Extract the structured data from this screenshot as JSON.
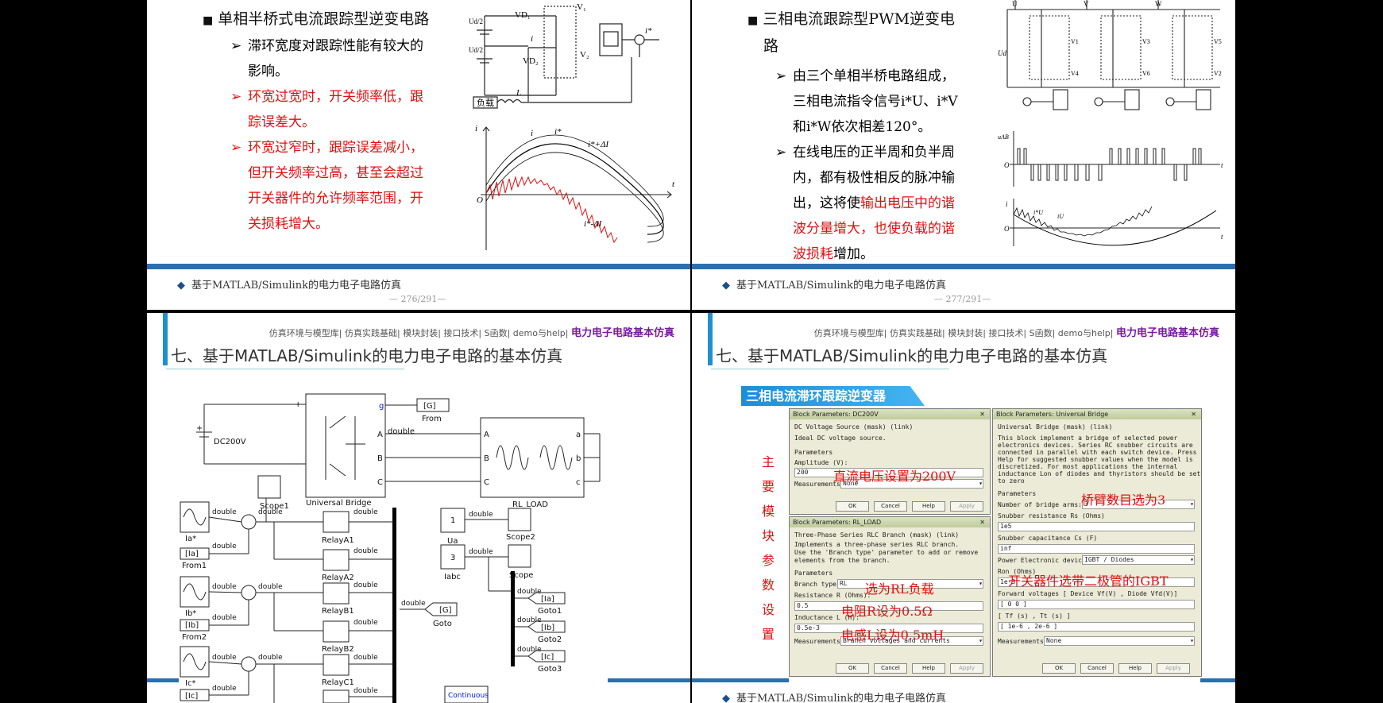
{
  "slide1": {
    "heading": "单相半桥式电流跟踪型逆变电路",
    "bullets": [
      {
        "text": "滞环宽度对跟踪性能有较大的",
        "cont": "影响。",
        "red": false
      },
      {
        "text": "环宽过宽时，开关频率低，跟",
        "cont": "踪误差大。",
        "red": true
      },
      {
        "text": "环宽过窄时，跟踪误差减小，",
        "cont": "但开关频率过高，甚至会超过",
        "cont2": "开关器件的允许频率范围，开",
        "cont3": "关损耗增大。",
        "red": true
      }
    ],
    "footer": "基于MATLAB/Simulink的电力电子电路仿真",
    "page": "— 276/291—",
    "circuit": {
      "load": "负载",
      "vd1": "VD₁",
      "vd2": "VD₂",
      "v1": "V₁",
      "v2": "V₂",
      "ud2a": "Ud/2",
      "ud2b": "Ud/2",
      "L": "L",
      "i": "i",
      "istar": "i*"
    },
    "wave": {
      "i": "i",
      "istar": "i*",
      "upper": "i*+ΔI",
      "lower": "i*-ΔI",
      "o": "O",
      "t": "t",
      "yi": "i"
    }
  },
  "slide2": {
    "heading1": "三相电流跟踪型PWM逆变电",
    "heading2": "路",
    "b1_l1": "由三个单相半桥电路组成，",
    "b1_l2": "三相电流指令信号i*U、i*V",
    "b1_l3": "和i*W依次相差120°。",
    "b2_l1": "在线电压的正半周和负半周",
    "b2_l2": "内，都有极性相反的脉冲输",
    "b2_l3a": "出，这将使",
    "b2_l3b": "输出电压中的谐",
    "b2_l4a": "波分量增大，也使",
    "b2_l4b": "负载的谐",
    "b2_l5a": "波损耗",
    "b2_l5b": "增加。",
    "footer": "基于MATLAB/Simulink的电力电子电路仿真",
    "page": "— 277/291—",
    "circuit": {
      "u": "U",
      "v": "V",
      "w": "W",
      "ud": "Ud",
      "v1": "V1",
      "v3": "V3",
      "v5": "V5",
      "v4": "V4",
      "v6": "V6",
      "v2": "V2"
    },
    "wave": {
      "uab": "uAB",
      "o": "O",
      "t": "t",
      "o2": "O",
      "t2": "t",
      "i": "i",
      "iu": "iU",
      "iustar": "i*U"
    }
  },
  "slide3": {
    "nav": "仿真环境与模型库| 仿真实践基础| 模块封装| 接口技术| S函数| demo与help|",
    "nav_bold": "电力电子电路基本仿真",
    "title": "七、基于MATLAB/Simulink的电力电子电路的基本仿真",
    "labels": {
      "dc": "DC200V",
      "ub": "Universal Bridge",
      "rl": "RL_LOAD",
      "from": "From",
      "g": "[G]",
      "double": "double",
      "scope1": "Scope1",
      "scope2": "Scope2",
      "scope": "Scope",
      "ua": "Ua",
      "iabc": "Iabc",
      "ia": "Ia*",
      "ib": "Ib*",
      "ic": "Ic*",
      "from1": "From1",
      "from2": "From2",
      "iatag": "[Ia]",
      "ibtag": "[Ib]",
      "ictag": "[Ic]",
      "ra1": "RelayA1",
      "ra2": "RelayA2",
      "rb1": "RelayB1",
      "rb2": "RelayB2",
      "rc1": "RelayC1",
      "goto": "Goto",
      "goto1": "Goto1",
      "goto2": "Goto2",
      "goto3": "Goto3",
      "one": "1",
      "three": "3",
      "cont": "Continuous",
      "pA": "A",
      "pB": "B",
      "pC": "C",
      "pa": "a",
      "pb": "b",
      "pc": "c",
      "pg": "g",
      "plus": "+",
      "minus": "-"
    }
  },
  "slide4": {
    "nav": "仿真环境与模型库| 仿真实践基础| 模块封装| 接口技术| S函数| demo与help|",
    "nav_bold": "电力电子电路基本仿真",
    "title": "七、基于MATLAB/Simulink的电力电子电路的基本仿真",
    "banner": "三相电流滞环跟踪逆变器",
    "vertical": [
      "主",
      "要",
      "模",
      "块",
      "参",
      "数",
      "设",
      "置"
    ],
    "dlg1": {
      "title": "Block Parameters: DC200V",
      "l1": "DC Voltage Source (mask) (link)",
      "l2": "Ideal DC voltage source.",
      "l3": "Parameters",
      "l4": "Amplitude (V):",
      "v4": "200",
      "l5": "Measurements",
      "v5": "None"
    },
    "dlg2": {
      "title": "Block Parameters: RL_LOAD",
      "l1": "Three-Phase Series RLC Branch (mask) (link)",
      "l2": "Implements a three-phase series RLC branch.",
      "l3": "Use the 'Branch type' parameter to add or remove",
      "l4": "elements from the branch.",
      "l5": "Parameters",
      "l6": "Branch type",
      "v6": "RL",
      "l7": "Resistance R (Ohms):",
      "v7": "0.5",
      "l8": "Inductance L (H):",
      "v8": "0.5e-3",
      "l9": "Measurements",
      "v9": "Branch voltages and currents"
    },
    "dlg3": {
      "title": "Block Parameters: Universal Bridge",
      "l1": "Universal Bridge (mask) (link)",
      "l2": "This block implement a bridge of selected power",
      "l3": "electronics devices.  Series RC snubber circuits are",
      "l4": "connected in parallel with each switch device.  Press",
      "l5": "Help for suggested snubber values when the model is",
      "l6": "discretized. For most applications the internal",
      "l7": "inductance Lon of diodes and thyristors should be set",
      "l8": "to zero",
      "l9": "Parameters",
      "l10": "Number of bridge arms:",
      "v10": "3",
      "l11": "Snubber resistance Rs (Ohms)",
      "v11": "1e5",
      "l12": "Snubber capacitance Cs (F)",
      "v12": "inf",
      "l13": "Power Electronic device",
      "v13": "IGBT / Diodes",
      "l14": "Ron (Ohms)",
      "v14": "1e-3",
      "l15": "Forward voltages  [ Device Vf(V) , Diode Vfd(V)]",
      "v15": "[ 0  0 ]",
      "l16": "[  Tf (s) , Tt (s)  ]",
      "v16": "[ 1e-6 , 2e-6 ]",
      "l17": "Measurements",
      "v17": "None"
    },
    "buttons": {
      "ok": "OK",
      "cancel": "Cancel",
      "help": "Help",
      "apply": "Apply"
    },
    "annots": {
      "a1": "直流电压设置为200V",
      "a2": "桥臂数目选为3",
      "a3": "开关器件选带二极管的IGBT",
      "a4": "选为RL负载",
      "a5": "电阻R设为0.5Ω",
      "a6": "电感L设为0.5mH"
    },
    "footer": "基于MATLAB/Simulink的电力电子电路仿真"
  }
}
